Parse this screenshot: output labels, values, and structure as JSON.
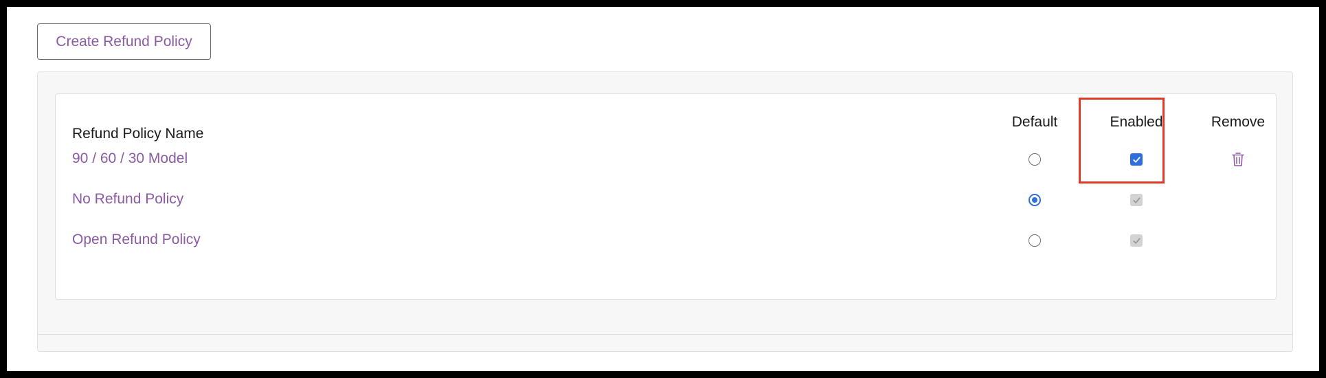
{
  "toolbar": {
    "create_label": "Create Refund Policy"
  },
  "table": {
    "headers": {
      "name": "Refund Policy Name",
      "default": "Default",
      "enabled": "Enabled",
      "remove": "Remove"
    },
    "rows": [
      {
        "name": "90 / 60 / 30 Model",
        "default": false,
        "enabled": true,
        "enabled_disabled": false,
        "removable": true
      },
      {
        "name": "No Refund Policy",
        "default": true,
        "enabled": true,
        "enabled_disabled": true,
        "removable": false
      },
      {
        "name": "Open Refund Policy",
        "default": false,
        "enabled": true,
        "enabled_disabled": true,
        "removable": false
      }
    ]
  },
  "icons": {
    "remove": "trash-icon",
    "check": "check-icon"
  },
  "colors": {
    "link": "#8a5aa3",
    "accent": "#2d6fe0",
    "highlight": "#e03a26"
  }
}
